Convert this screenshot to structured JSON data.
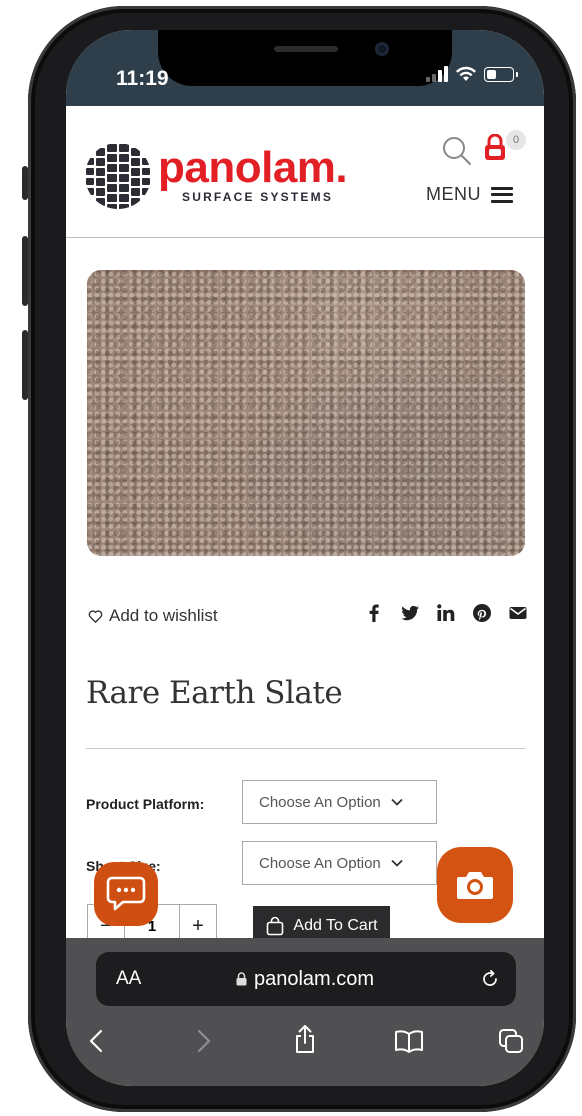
{
  "status": {
    "time": "11:19"
  },
  "header": {
    "brand": "panolam.",
    "subbrand": "SURFACE SYSTEMS",
    "cart_count": "0",
    "menu_label": "MENU"
  },
  "product": {
    "wishlist_label": "Add to wishlist",
    "title": "Rare Earth Slate",
    "options": [
      {
        "label": "Product Platform:",
        "placeholder": "Choose An Option"
      },
      {
        "label": "Sheet Size:",
        "placeholder": "Choose An Option"
      }
    ],
    "quantity": {
      "minus": "−",
      "value": "1",
      "plus": "+"
    },
    "add_to_cart": "Add To Cart"
  },
  "safari": {
    "aa_label": "AA",
    "url": "panolam.com"
  },
  "colors": {
    "brand_red": "#e31f26",
    "fab_orange": "#d35312",
    "status_bar_bg": "#2e3f4b"
  }
}
